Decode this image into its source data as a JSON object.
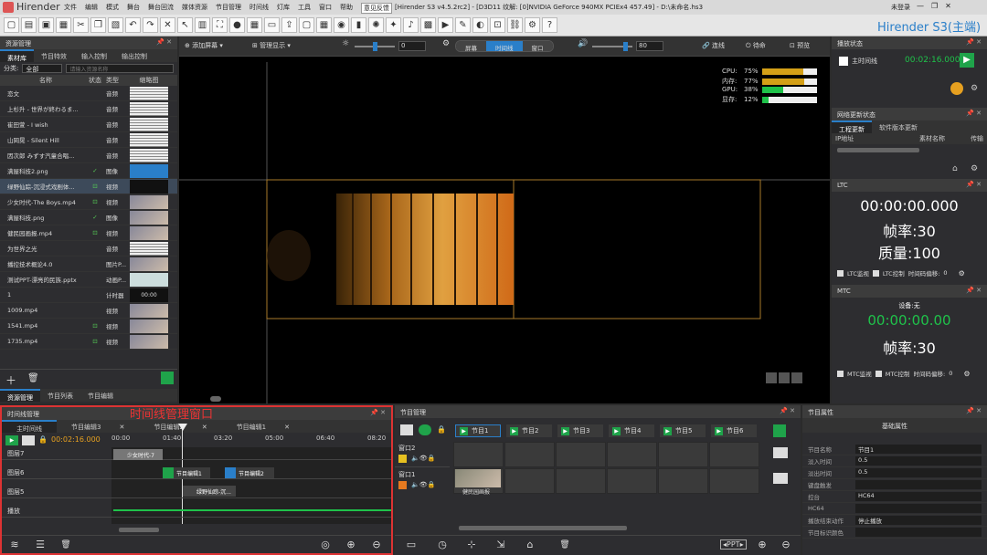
{
  "titlebar": {
    "app": "Hirender",
    "menus": [
      "文件",
      "编辑",
      "模式",
      "舞台",
      "舞台回流",
      "媒体资源",
      "节目管理",
      "时间线",
      "灯库",
      "工具",
      "窗口",
      "帮助",
      "意见反馈"
    ],
    "highlight_menu": "意见反馈",
    "window_title": "[Hirender S3 v4.5.2rc2] - [D3D11 纹解: [0]NVIDIA GeForce 940MX PCIEx4 457.49] - D:\\未命名.hs3",
    "login": "未登录",
    "controls": [
      "—",
      "❐",
      "✕"
    ]
  },
  "toolbar": {
    "icons": [
      "new-file-icon",
      "open-folder-icon",
      "save-icon",
      "save-as-icon",
      "cut-icon",
      "copy-icon",
      "paste-icon",
      "undo-icon",
      "redo-icon",
      "delete-icon",
      "select-icon",
      "media-icon",
      "fullscreen-icon",
      "record-icon",
      "layout-icon",
      "screen-icon",
      "output-icon",
      "window-icon",
      "grid-icon",
      "camera-icon",
      "chart-icon",
      "light-icon",
      "effect-icon",
      "audio-icon",
      "stage-icon",
      "preview-icon",
      "script-icon",
      "color-icon",
      "capture-icon",
      "link-icon",
      "settings-icon",
      "help-icon"
    ],
    "brand": "Hirender S3(主端)"
  },
  "left": {
    "title": "资源管理",
    "tabs": [
      "素材库",
      "节目特效",
      "输入控制",
      "输出控制"
    ],
    "filter_label": "分类:",
    "filter_value": "全部",
    "search_placeholder": "请输入资源名称",
    "columns": [
      "名称",
      "状态",
      "类型",
      "缩略图"
    ],
    "rows": [
      {
        "name": "恋文",
        "status": "",
        "type": "音频",
        "thumb": "audio"
      },
      {
        "name": "上杉升 - 世界が終わるま...",
        "status": "",
        "type": "音频",
        "thumb": "audio"
      },
      {
        "name": "崔田萱 - I wish",
        "status": "",
        "type": "音频",
        "thumb": "audio"
      },
      {
        "name": "山岡晃 - Silent Hill",
        "status": "",
        "type": "音频",
        "thumb": "audio"
      },
      {
        "name": "因次郎 みずす汽童合唱...",
        "status": "",
        "type": "音频",
        "thumb": "audio"
      },
      {
        "name": "满屋科技2.png",
        "status": "✓",
        "type": "图像",
        "thumb": "blue"
      },
      {
        "name": "绿野仙踪-沉浸式戏剧体...",
        "status": "⊡",
        "type": "视频",
        "thumb": "dark"
      },
      {
        "name": "少女时代-The Boys.mp4",
        "status": "⊡",
        "type": "视频",
        "thumb": "img"
      },
      {
        "name": "满屋科技.png",
        "status": "✓",
        "type": "图像",
        "thumb": "img"
      },
      {
        "name": "健民园画报.mp4",
        "status": "⊡",
        "type": "视频",
        "thumb": "img"
      },
      {
        "name": "为世界之光",
        "status": "",
        "type": "音频",
        "thumb": "audio"
      },
      {
        "name": "播控技术概论4.0",
        "status": "",
        "type": "图片P...",
        "thumb": "img"
      },
      {
        "name": "测试PPT-漂亮的民族.pptx",
        "status": "",
        "type": "动画P...",
        "thumb": "ppt"
      },
      {
        "name": "1",
        "status": "",
        "type": "计时器",
        "thumb": "timer"
      },
      {
        "name": "1009.mp4",
        "status": "",
        "type": "视频",
        "thumb": "img"
      },
      {
        "name": "1541.mp4",
        "status": "⊡",
        "type": "视频",
        "thumb": "img"
      },
      {
        "name": "1735.mp4",
        "status": "⊡",
        "type": "视频",
        "thumb": "img"
      }
    ],
    "timer_thumb": "00:00",
    "bottom_tabs": [
      "资源管理",
      "节目列表",
      "节目编辑"
    ]
  },
  "stagebar": {
    "add_screen": "添加屏幕",
    "manage": "管理显示",
    "brightness_value": "0",
    "segments": [
      "屏幕",
      "时间线",
      "窗口"
    ],
    "active_segment": "时间线",
    "volume_value": "80",
    "buttons": [
      "连线",
      "待命",
      "预览"
    ]
  },
  "gauges": [
    {
      "label": "CPU:",
      "value": "75%",
      "fraction": 0.75,
      "color": "#d4a017"
    },
    {
      "label": "内存:",
      "value": "77%",
      "fraction": 0.77,
      "color": "#d4a017"
    },
    {
      "label": "GPU:",
      "value": "38%",
      "fraction": 0.38,
      "color": "#1fc24a"
    },
    {
      "label": "显存:",
      "value": "12%",
      "fraction": 0.12,
      "color": "#1fc24a"
    }
  ],
  "right": {
    "play_state_title": "播放状态",
    "main_timeline": "主时间线",
    "main_time": "00:02:16.000",
    "net_title": "网络更新状态",
    "net_tabs": [
      "工程更新",
      "软件版本更新"
    ],
    "net_cols": [
      "IP地址",
      "素材名称",
      "传输"
    ],
    "ltc_title": "LTC",
    "ltc_time": "00:00:00.000",
    "ltc_rate": "帧率:30",
    "ltc_quality": "质量:100",
    "ltc_opts": [
      "LTC监视",
      "LTC控制",
      "时间码偏移:",
      "0"
    ],
    "mtc_title": "MTC",
    "mtc_device": "设备:无",
    "mtc_time": "00:00:00.00",
    "mtc_rate": "帧率:30",
    "mtc_opts": [
      "MTC监视",
      "MTC控制",
      "时间码偏移:",
      "0"
    ]
  },
  "timeline": {
    "title": "时间线管理",
    "annotation": "时间线管理窗口",
    "tabs": [
      "主时间线",
      "节目编辑3",
      "节目编辑2",
      "节目编辑1"
    ],
    "time": "00:02:16.000",
    "ruler": [
      "00:00",
      "01:40",
      "03:20",
      "05:00",
      "06:40",
      "08:20"
    ],
    "tracks": [
      "图层7",
      "图层6",
      "图层5",
      "播放"
    ],
    "clips": [
      "少女时代-7",
      "节目编辑1",
      "节目编辑2",
      "绿野仙踪-沉..."
    ]
  },
  "program": {
    "title": "节目管理",
    "tabs": [
      "节目1",
      "节目2",
      "节目3",
      "节目4",
      "节目5",
      "节目6"
    ],
    "windows": [
      "窗口2",
      "窗口1"
    ],
    "clip": "健民园画报",
    "ppt": "PPT"
  },
  "props": {
    "title": "节目属性",
    "section": "基础属性",
    "rows": [
      {
        "k": "节目名称",
        "v": "节目1"
      },
      {
        "k": "淡入时间",
        "v": "0.5"
      },
      {
        "k": "淡出时间",
        "v": "0.5"
      },
      {
        "k": "键盘触发",
        "v": ""
      },
      {
        "k": "控台",
        "v": "HC64"
      },
      {
        "k": "HC64",
        "v": ""
      },
      {
        "k": "播放结束动作",
        "v": "停止播放"
      },
      {
        "k": "节目标识颜色",
        "v": ""
      }
    ]
  }
}
